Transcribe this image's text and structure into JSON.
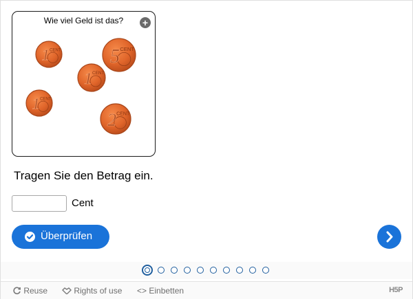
{
  "task": {
    "image_title": "Wie viel Geld ist das?",
    "coins": [
      {
        "value": "1",
        "unit": "CENT"
      },
      {
        "value": "5",
        "unit": "CENT"
      },
      {
        "value": "1",
        "unit": "CENT"
      },
      {
        "value": "1",
        "unit": "CENT"
      },
      {
        "value": "2",
        "unit": "CENT"
      }
    ],
    "prompt": "Tragen Sie den Betrag ein.",
    "answer_value": "",
    "unit_label": "Cent",
    "check_label": "Überprüfen"
  },
  "navigation": {
    "total_slides": 10,
    "current_slide": 1
  },
  "footer": {
    "reuse_label": "Reuse",
    "rights_label": "Rights of use",
    "embed_label": "Einbetten",
    "brand": "H5P"
  },
  "colors": {
    "accent": "#1a73d9",
    "coin_copper": "#e06a2a",
    "dot_border": "#1f5e9e"
  }
}
